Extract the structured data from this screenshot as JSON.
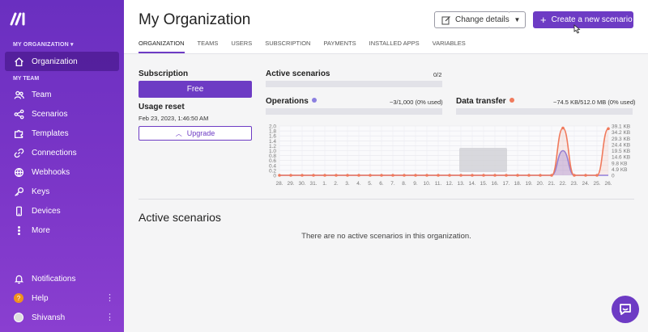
{
  "sidebar": {
    "org_switch_label": "MY ORGANIZATION ▾",
    "org_item_label": "Organization",
    "team_section_label": "MY TEAM",
    "items": [
      {
        "label": "Team",
        "icon": "team-icon"
      },
      {
        "label": "Scenarios",
        "icon": "share-icon"
      },
      {
        "label": "Templates",
        "icon": "puzzle-icon"
      },
      {
        "label": "Connections",
        "icon": "link-icon"
      },
      {
        "label": "Webhooks",
        "icon": "globe-icon"
      },
      {
        "label": "Keys",
        "icon": "key-icon"
      },
      {
        "label": "Devices",
        "icon": "phone-icon"
      },
      {
        "label": "More",
        "icon": "more-icon"
      }
    ],
    "bottom": {
      "notifications": "Notifications",
      "help": "Help",
      "help_badge": "?",
      "user": "Shivansh"
    }
  },
  "header": {
    "title": "My Organization",
    "change_details": "Change details",
    "create_scenario": "Create a new scenario",
    "tabs": [
      "ORGANIZATION",
      "TEAMS",
      "USERS",
      "SUBSCRIPTION",
      "PAYMENTS",
      "INSTALLED APPS",
      "VARIABLES"
    ]
  },
  "subscription": {
    "title": "Subscription",
    "plan": "Free",
    "usage_reset_title": "Usage reset",
    "usage_reset_date": "Feb 23, 2023, 1:46:50 AM",
    "upgrade_label": "Upgrade"
  },
  "metrics": {
    "active_scenarios_title": "Active scenarios",
    "active_scenarios_value": "0/2",
    "operations_title": "Operations",
    "operations_value": "~3/1,000 (0% used)",
    "operations_color": "#8b7fe0",
    "data_transfer_title": "Data transfer",
    "data_transfer_value": "~74.5 KB/512.0 MB (0% used)",
    "data_transfer_color": "#f07a5c"
  },
  "chart_data": {
    "type": "area",
    "x": [
      "28.",
      "29.",
      "30.",
      "31.",
      "1.",
      "2.",
      "3.",
      "4.",
      "5.",
      "6.",
      "7.",
      "8.",
      "9.",
      "10.",
      "11.",
      "12.",
      "13.",
      "14.",
      "15.",
      "16.",
      "17.",
      "18.",
      "19.",
      "20.",
      "21.",
      "22.",
      "23.",
      "24.",
      "25.",
      "26."
    ],
    "y_left_ticks": [
      "2.0",
      "1.8",
      "1.6",
      "1.4",
      "1.2",
      "1.0",
      "0.8",
      "0.6",
      "0.4",
      "0.2",
      "0"
    ],
    "y_right_ticks": [
      "39.1 KB",
      "34.2 KB",
      "29.3 KB",
      "24.4 KB",
      "19.5 KB",
      "14.6 KB",
      "9.8 KB",
      "4.9 KB",
      "0"
    ],
    "ylim_left": [
      0,
      2.0
    ],
    "ylim_right_kb": [
      0,
      39.1
    ],
    "series": [
      {
        "name": "Operations",
        "color": "#8b7fe0",
        "axis": "left",
        "values": [
          0,
          0,
          0,
          0,
          0,
          0,
          0,
          0,
          0,
          0,
          0,
          0,
          0,
          0,
          0,
          0,
          0,
          0,
          0,
          0,
          0,
          0,
          0,
          0,
          0,
          1.0,
          0,
          0,
          0,
          0
        ]
      },
      {
        "name": "Data transfer",
        "color": "#f07a5c",
        "axis": "right",
        "values": [
          0,
          0,
          0,
          0,
          0,
          0,
          0,
          0,
          0,
          0,
          0,
          0,
          0,
          0,
          0,
          0,
          0,
          0,
          0,
          0,
          0,
          0,
          0,
          0,
          0,
          37.5,
          0,
          0,
          0,
          37.0
        ]
      }
    ],
    "grid": true
  },
  "active_scenarios": {
    "heading": "Active scenarios",
    "empty_message": "There are no active scenarios in this organization."
  }
}
